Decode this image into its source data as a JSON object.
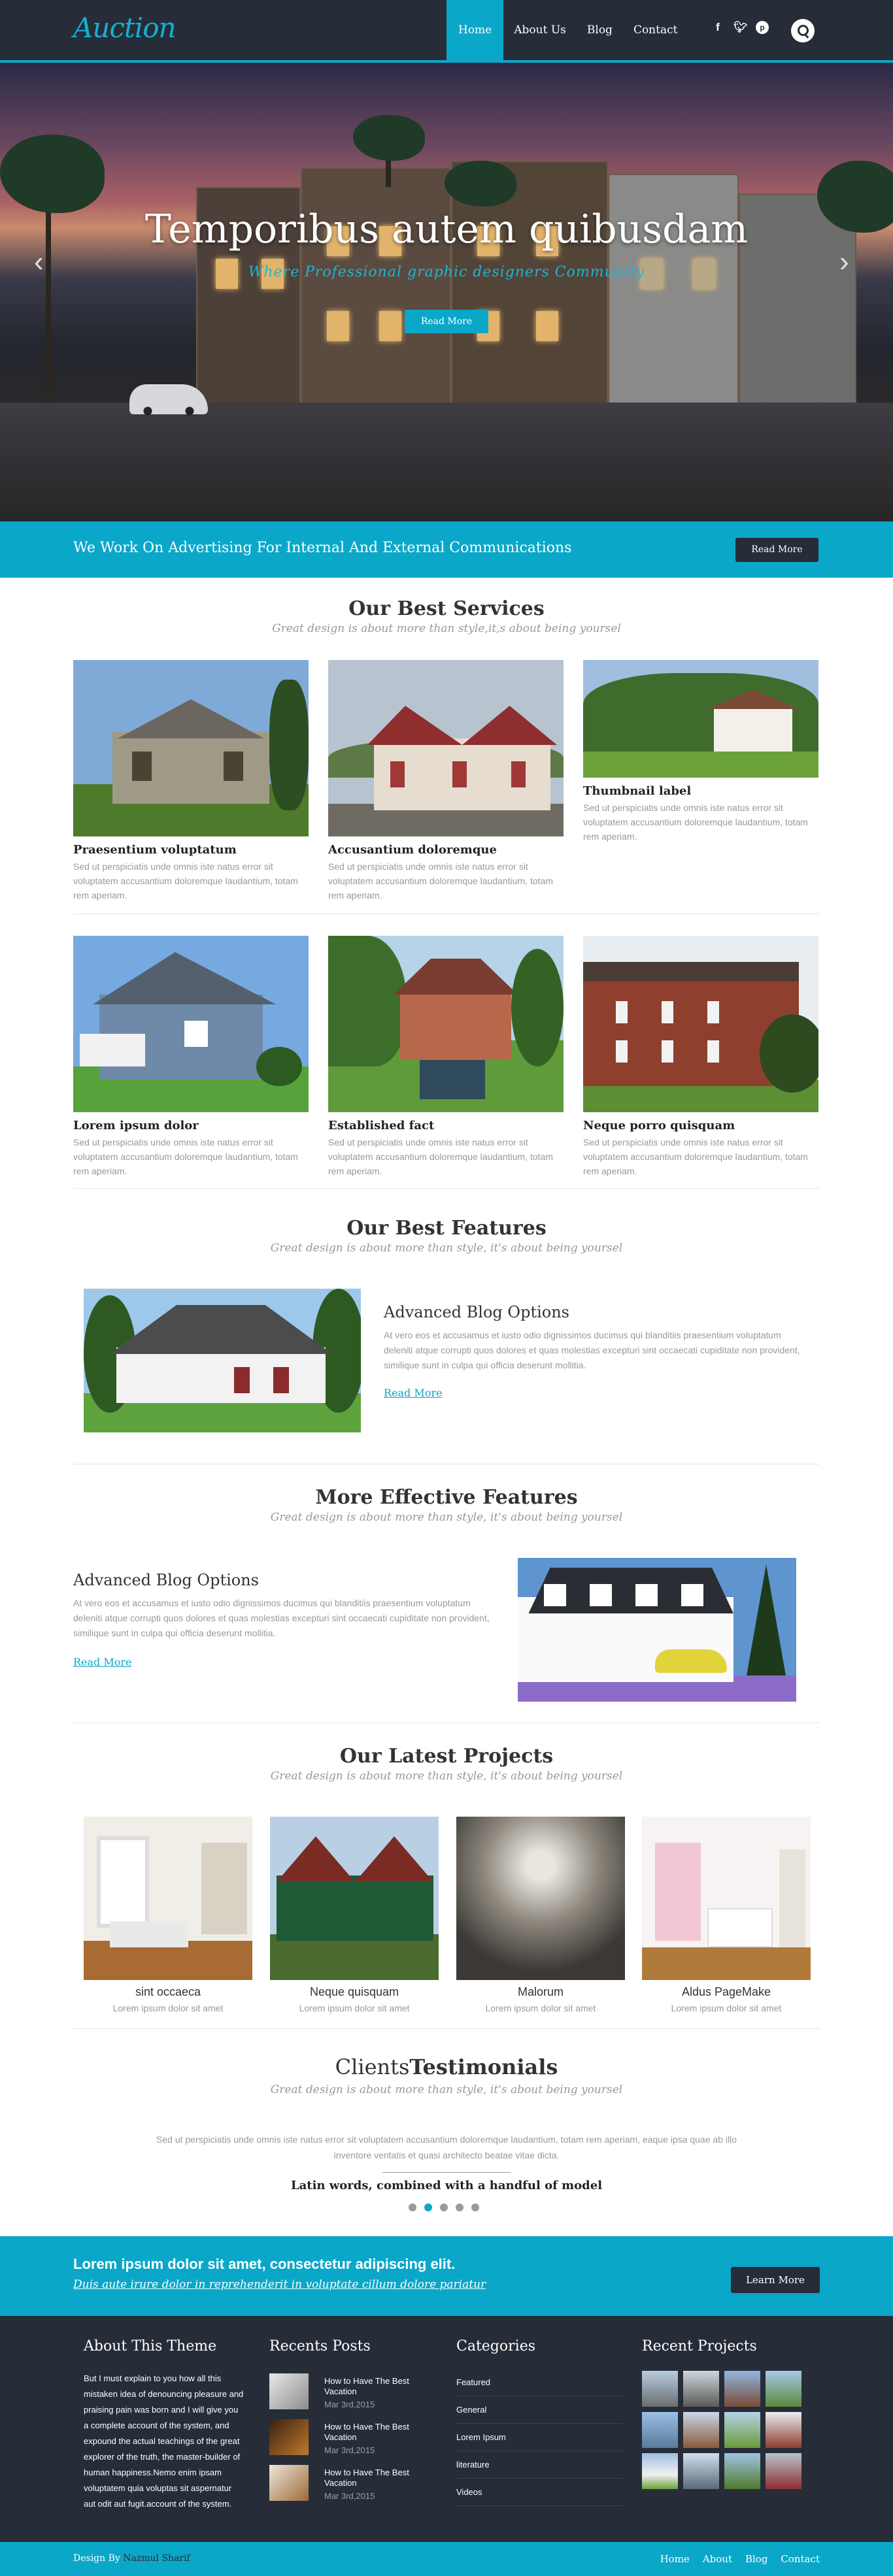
{
  "header": {
    "logo": "Auction",
    "nav": [
      "Home",
      "About Us",
      "Blog",
      "Contact"
    ],
    "social": [
      "facebook-icon",
      "twitter-icon",
      "pinterest-icon"
    ]
  },
  "hero": {
    "title": "Temporibus autem quibusdam",
    "subtitle": "Where Professional graphic designers Community",
    "button": "Read More"
  },
  "cta": {
    "text": "We Work On Advertising For Internal And External Communications",
    "button": "Read More"
  },
  "services": {
    "title": "Our Best Services",
    "subtitle": "Great design is about more than style,it,s about being yoursel",
    "items": [
      {
        "title": "Praesentium voluptatum",
        "desc": "Sed ut perspiciatis unde omnis iste natus error sit voluptatem accusantium doloremque laudantium, totam rem aperiam."
      },
      {
        "title": "Accusantium doloremque",
        "desc": "Sed ut perspiciatis unde omnis iste natus error sit voluptatem accusantium doloremque laudantium, totam rem aperiam."
      },
      {
        "title": "Thumbnail label",
        "desc": "Sed ut perspiciatis unde omnis iste natus error sit voluptatem accusantium doloremque laudantium, totam rem aperiam."
      },
      {
        "title": "Lorem ipsum dolor",
        "desc": "Sed ut perspiciatis unde omnis iste natus error sit voluptatem accusantium doloremque laudantium, totam rem aperiam."
      },
      {
        "title": "Established fact",
        "desc": "Sed ut perspiciatis unde omnis iste natus error sit voluptatem accusantium doloremque laudantium, totam rem aperiam."
      },
      {
        "title": "Neque porro quisquam",
        "desc": "Sed ut perspiciatis unde omnis iste natus error sit voluptatem accusantium doloremque laudantium, totam rem aperiam."
      }
    ]
  },
  "features": {
    "title": "Our Best Features",
    "subtitle": "Great design is about more than style, it's about being yoursel",
    "block_title": "Advanced Blog Options",
    "block_text": "At vero eos et accusamus et iusto odio dignissimos ducimus qui blanditiis praesentium voluptatum deleniti atque corrupti quos dolores et quas molestias excepturi sint occaecati cupiditate non provident, similique sunt in culpa qui officia deserunt mollitia.",
    "link": "Read More"
  },
  "effective": {
    "title": "More Effective Features",
    "subtitle": "Great design is about more than style, it's about being yoursel",
    "block_title": "Advanced Blog Options",
    "block_text": "At vero eos et accusamus et iusto odio dignissimos ducimus qui blanditiis praesentium voluptatum deleniti atque corrupti quos dolores et quas molestias excepturi sint occaecati cupiditate non provident, similique sunt in culpa qui officia deserunt mollitia.",
    "link": "Read More"
  },
  "projects": {
    "title": "Our Latest Projects",
    "subtitle": "Great design is about more than style, it's about being yoursel",
    "items": [
      {
        "title": "sint occaeca",
        "desc": "Lorem ipsum dolor sit amet"
      },
      {
        "title": "Neque quisquam",
        "desc": "Lorem ipsum dolor sit amet"
      },
      {
        "title": "Malorum",
        "desc": "Lorem ipsum dolor sit amet"
      },
      {
        "title": "Aldus PageMake",
        "desc": "Lorem ipsum dolor sit amet"
      }
    ]
  },
  "testimonials": {
    "title_light": "Clients",
    "title_bold": "Testimonials",
    "subtitle": "Great design is about more than style, it's about being yoursel",
    "quote": "Sed ut perspiciatis unde omnis iste natus error sit voluptatem accusantium doloremque laudantium, totam rem aperiam, eaque ipsa quae ab illo inventore veritatis et quasi architecto beatae vitae dicta.",
    "author": "Latin words, combined with a handful of model",
    "active_dot": 1
  },
  "cta2": {
    "heading": "Lorem ipsum dolor sit amet, consectetur adipiscing elit.",
    "sub": "Duis aute irure dolor in reprehenderit in voluptate cillum dolore pariatur",
    "button": "Learn More"
  },
  "footer": {
    "about_title": "About This Theme",
    "about_text": "But I must explain to you how all this mistaken idea of denouncing pleasure and praising pain was born and I will give you a complete account of the system, and expound the actual teachings of the great explorer of the truth, the master-builder of human happiness.Nemo enim ipsam voluptatem quia voluptas sit aspernatur aut odit aut fugit.account of the system.",
    "posts_title": "Recents Posts",
    "posts": [
      {
        "title": "How to Have The Best Vacation",
        "date": "Mar 3rd,2015"
      },
      {
        "title": "How to Have The Best Vacation",
        "date": "Mar 3rd,2015"
      },
      {
        "title": "How to Have The Best Vacation",
        "date": "Mar 3rd,2015"
      }
    ],
    "categories_title": "Categories",
    "categories": [
      "Featured",
      "General",
      "Lorem Ipsum",
      "literature",
      "Videos"
    ],
    "projects_title": "Recent Projects",
    "credit_prefix": "Design By",
    "credit_name": "Nazmul Sharif",
    "nav": [
      "Home",
      "About",
      "Blog",
      "Contact"
    ]
  },
  "colors": {
    "accent": "#0ba7c9",
    "dark": "#262d38"
  }
}
